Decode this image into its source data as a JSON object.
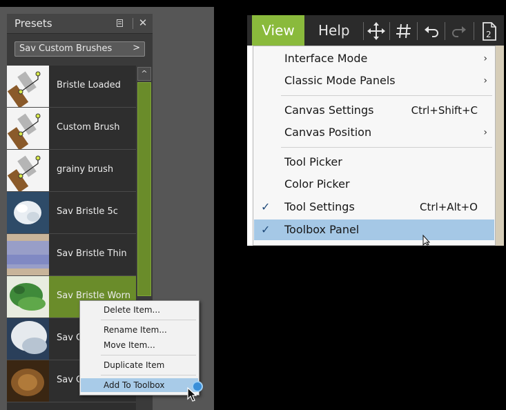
{
  "presets_panel": {
    "title": "Presets",
    "close": "✕",
    "category": "Sav Custom Brushes",
    "category_arrow": ">",
    "scroll_up": "^",
    "items": [
      {
        "label": "Bristle Loaded"
      },
      {
        "label": "Custom Brush"
      },
      {
        "label": "grainy brush"
      },
      {
        "label": "Sav Bristle 5c"
      },
      {
        "label": "Sav Bristle Thin"
      },
      {
        "label": "Sav Bristle Worn"
      },
      {
        "label": "Sav C"
      },
      {
        "label": "Sav C"
      }
    ],
    "selected_item": "Sav Bristle Worn"
  },
  "context_menu": {
    "items": [
      {
        "label": "Delete Item..."
      },
      {
        "label": "Rename Item..."
      },
      {
        "label": "Move Item..."
      },
      {
        "label": "Duplicate Item"
      },
      {
        "label": "Add To Toolbox"
      }
    ],
    "highlighted": "Add To Toolbox"
  },
  "menubar": {
    "view": "View",
    "help": "Help",
    "icons": [
      "move-icon",
      "grid-icon",
      "undo-icon",
      "redo-icon",
      "page-icon"
    ]
  },
  "view_menu": {
    "items": [
      {
        "label": "Interface Mode",
        "arrow": "›"
      },
      {
        "label": "Classic Mode Panels",
        "arrow": "›"
      },
      {
        "label": "Canvas Settings",
        "shortcut": "Ctrl+Shift+C"
      },
      {
        "label": "Canvas Position",
        "arrow": "›"
      },
      {
        "label": "Tool Picker"
      },
      {
        "label": "Color Picker"
      },
      {
        "label": "Tool Settings",
        "shortcut": "Ctrl+Alt+O",
        "checked": "✓"
      },
      {
        "label": "Toolbox Panel",
        "checked": "✓"
      }
    ],
    "highlighted": "Toolbox Panel"
  },
  "colors": {
    "accent_green": "#8aba3c",
    "selection_green": "#6a8c2a",
    "menu_highlight": "#a5c8e6"
  }
}
